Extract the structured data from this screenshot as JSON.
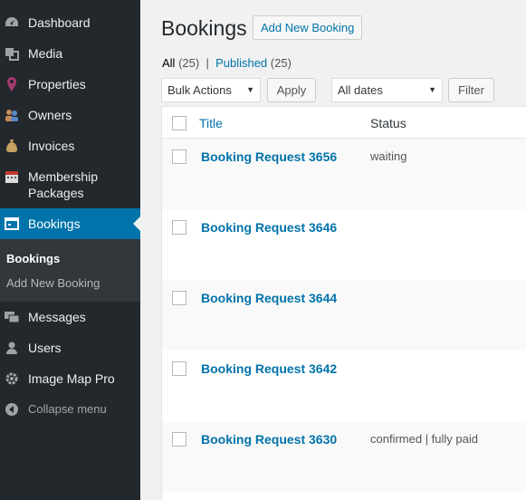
{
  "sidebar": {
    "items": [
      {
        "label": "Dashboard",
        "icon": "dashboard-icon"
      },
      {
        "label": "Media",
        "icon": "media-icon"
      },
      {
        "label": "Properties",
        "icon": "map-pin-icon"
      },
      {
        "label": "Owners",
        "icon": "people-icon"
      },
      {
        "label": "Invoices",
        "icon": "money-bag-icon"
      },
      {
        "label": "Membership Packages",
        "label_line1": "Membership",
        "label_line2": "Packages",
        "icon": "calendar-icon"
      },
      {
        "label": "Bookings",
        "icon": "booking-icon"
      },
      {
        "label": "Messages",
        "icon": "chat-icon"
      },
      {
        "label": "Users",
        "icon": "user-icon"
      },
      {
        "label": "Image Map Pro",
        "icon": "settings-icon"
      },
      {
        "label": "Collapse menu",
        "icon": "collapse-icon"
      }
    ],
    "submenu": [
      {
        "label": "Bookings"
      },
      {
        "label": "Add New Booking"
      }
    ],
    "accent": "#0073aa",
    "background": "#23282d"
  },
  "header": {
    "title": "Bookings",
    "add_new_label": "Add New Booking"
  },
  "filters": {
    "all_label": "All",
    "all_count": "(25)",
    "separator": "|",
    "published_label": "Published",
    "published_count": "(25)",
    "bulk_actions": "Bulk Actions",
    "apply_label": "Apply",
    "dates": "All dates",
    "filter_label": "Filter"
  },
  "table": {
    "columns": [
      "Title",
      "Status"
    ],
    "rows": [
      {
        "title": "Booking Request 3656",
        "status": "waiting"
      },
      {
        "title": "Booking Request 3646",
        "status": ""
      },
      {
        "title": "Booking Request 3644",
        "status": ""
      },
      {
        "title": "Booking Request 3642",
        "status": ""
      },
      {
        "title": "Booking Request 3630",
        "status": "confirmed | fully paid"
      }
    ]
  }
}
